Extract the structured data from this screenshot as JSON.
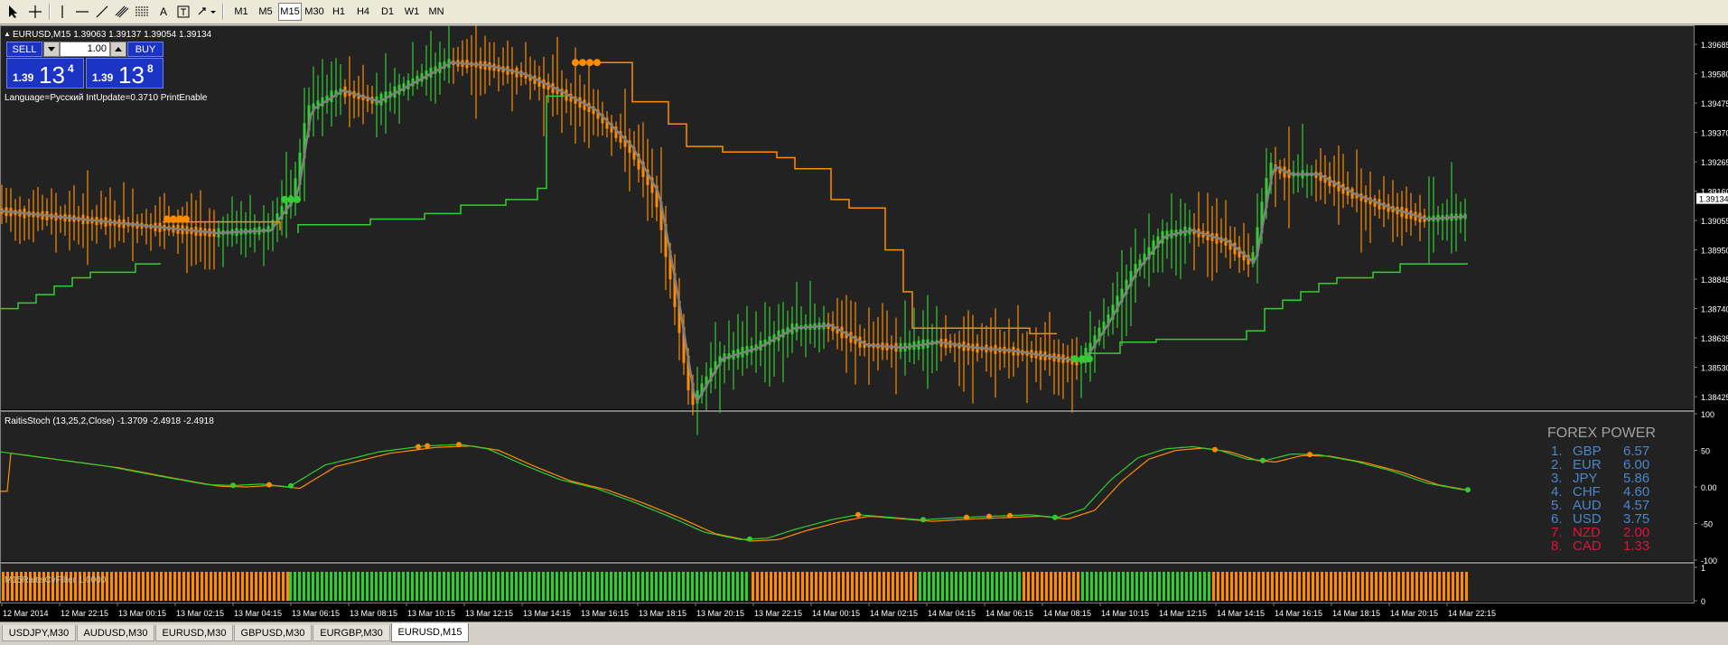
{
  "toolbar": {
    "timeframes": [
      "M1",
      "M5",
      "M15",
      "M30",
      "H1",
      "H4",
      "D1",
      "W1",
      "MN"
    ],
    "active_timeframe": "M15"
  },
  "main_window": {
    "symbol_info": "EURUSD,M15  1.39063 1.39137 1.39054 1.39134",
    "params": "Language=Русский  IntUpdate=0.3710  PrintEnable",
    "price_axis": [
      "1.39685",
      "1.39580",
      "1.39475",
      "1.39370",
      "1.39265",
      "1.39160",
      "1.39055",
      "1.38950",
      "1.38845",
      "1.38740",
      "1.38635",
      "1.38530",
      "1.38425"
    ],
    "current_price": "1.39134"
  },
  "trade_panel": {
    "sell_label": "SELL",
    "buy_label": "BUY",
    "lot": "1.00",
    "sell_big": "1.39",
    "sell_main": "13",
    "sell_sup": "4",
    "buy_big": "1.39",
    "buy_main": "13",
    "buy_sup": "8"
  },
  "stoch_window": {
    "title": "RaitisStoch (13,25,2,Close) -1.3709 -2.4918 -2.4918",
    "axis": [
      "100",
      "50",
      "0.00",
      "-50",
      "-100"
    ]
  },
  "filter_window": {
    "title": "M15RaitisCvFilter 1.0000",
    "axis": [
      "1",
      "0"
    ]
  },
  "forex_power": {
    "title": "FOREX POWER",
    "rows": [
      {
        "rank": "1.",
        "cur": "GBP",
        "val": "6.57",
        "color": "#4a86c8"
      },
      {
        "rank": "2.",
        "cur": "EUR",
        "val": "6.00",
        "color": "#4a86c8"
      },
      {
        "rank": "3.",
        "cur": "JPY",
        "val": "5.86",
        "color": "#4a86c8"
      },
      {
        "rank": "4.",
        "cur": "CHF",
        "val": "4.60",
        "color": "#4a86c8"
      },
      {
        "rank": "5.",
        "cur": "AUD",
        "val": "4.57",
        "color": "#4a86c8"
      },
      {
        "rank": "6.",
        "cur": "USD",
        "val": "3.75",
        "color": "#4a86c8"
      },
      {
        "rank": "7.",
        "cur": "NZD",
        "val": "2.00",
        "color": "#dc143c"
      },
      {
        "rank": "8.",
        "cur": "CAD",
        "val": "1.33",
        "color": "#dc143c"
      }
    ]
  },
  "time_axis": [
    "12 Mar 2014",
    "12 Mar 22:15",
    "13 Mar 00:15",
    "13 Mar 02:15",
    "13 Mar 04:15",
    "13 Mar 06:15",
    "13 Mar 08:15",
    "13 Mar 10:15",
    "13 Mar 12:15",
    "13 Mar 14:15",
    "13 Mar 16:15",
    "13 Mar 18:15",
    "13 Mar 20:15",
    "13 Mar 22:15",
    "14 Mar 00:15",
    "14 Mar 02:15",
    "14 Mar 04:15",
    "14 Mar 06:15",
    "14 Mar 08:15",
    "14 Mar 10:15",
    "14 Mar 12:15",
    "14 Mar 14:15",
    "14 Mar 16:15",
    "14 Mar 18:15",
    "14 Mar 20:15",
    "14 Mar 22:15"
  ],
  "symbol_tabs": [
    "USDJPY,M30",
    "AUDUSD,M30",
    "EURUSD,M30",
    "GBPUSD,M30",
    "EURGBP,M30",
    "EURUSD,M15"
  ],
  "active_tab": "EURUSD,M15",
  "colors": {
    "bull": "#32cd32",
    "bear": "#ff8c00",
    "smooth": "#808080",
    "background": "#000000"
  }
}
